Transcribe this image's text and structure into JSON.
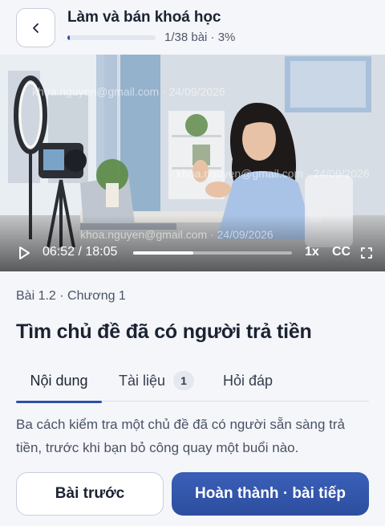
{
  "header": {
    "back_icon": "chevron-left-icon",
    "course_title": "Làm và bán khoá học",
    "progress_fraction": 0.03,
    "progress_text": "1/38 bài · 3%"
  },
  "video": {
    "watermark_email": "khoa.nguyen@gmail.com",
    "watermark_date": "24/09/2026",
    "watermarks": [
      "khoa.nguyen@gmail.com · 24/09/2026",
      "khoa.nguyen@gmail.com · 24/09/2026",
      "khoa.nguyen@gmail.com · 24/09/2026"
    ],
    "time_text": "06:52 / 18:05",
    "played_fraction": 0.38,
    "speed": "1x",
    "captions": "CC",
    "play_icon": "play-icon",
    "fullscreen_icon": "fullscreen-icon"
  },
  "lesson": {
    "meta": "Bài 1.2 · Chương 1",
    "title": "Tìm chủ đề đã có người trả tiền",
    "description": "Ba cách kiểm tra một chủ đề đã có người sẵn sàng trả tiền, trước khi bạn bỏ công quay một buổi nào."
  },
  "tabs": {
    "content": "Nội dung",
    "docs": "Tài liệu",
    "docs_count": "1",
    "qa": "Hỏi đáp",
    "active": "content"
  },
  "actions": {
    "prev_label": "Bài trước",
    "next_label": "Hoàn thành · bài tiếp"
  },
  "colors": {
    "accent": "#2e4fa8",
    "background": "#f4f6fa"
  }
}
